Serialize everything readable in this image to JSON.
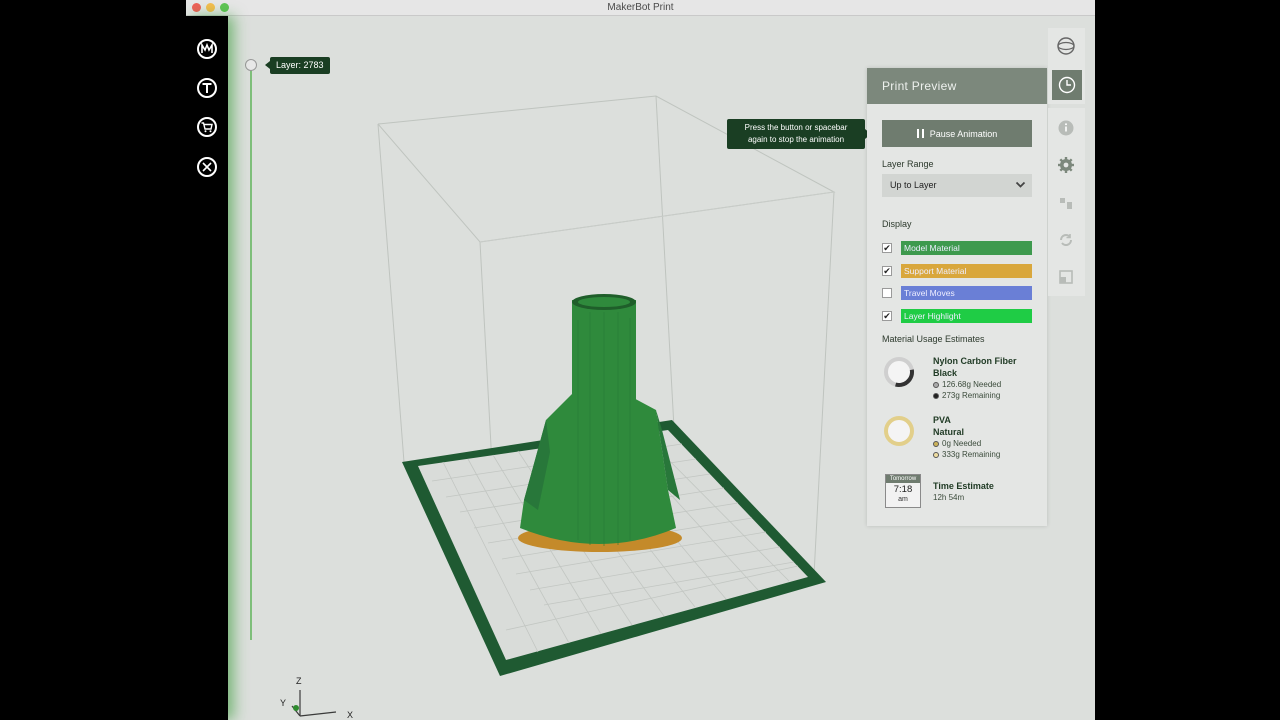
{
  "window": {
    "title": "MakerBot Print"
  },
  "left_nav": {
    "icons": [
      {
        "name": "makerbot-logo-icon",
        "glyph": "M"
      },
      {
        "name": "thingiverse-icon",
        "glyph": "T"
      },
      {
        "name": "store-cart-icon",
        "glyph": "cart"
      },
      {
        "name": "utilities-icon",
        "glyph": "tools"
      }
    ]
  },
  "layer_slider": {
    "label": "Layer: 2783"
  },
  "hint": {
    "line1": "Press the button or spacebar",
    "line2": "again to stop the animation"
  },
  "print_preview": {
    "title": "Print Preview",
    "pause_button": "Pause Animation",
    "layer_range_label": "Layer Range",
    "layer_range_value": "Up to Layer",
    "display_label": "Display",
    "display_items": [
      {
        "label": "Model Material",
        "checked": true,
        "color": "#3e9a4e"
      },
      {
        "label": "Support Material",
        "checked": true,
        "color": "#d9a73c"
      },
      {
        "label": "Travel Moves",
        "checked": false,
        "color": "#6a7fd6"
      },
      {
        "label": "Layer Highlight",
        "checked": true,
        "color": "#1fcc45"
      }
    ],
    "material_usage_label": "Material Usage Estimates",
    "materials": [
      {
        "name_line1": "Nylon Carbon Fiber",
        "name_line2": "Black",
        "needed": "126.68g  Needed",
        "remaining": "273g  Remaining",
        "fill": 0.32,
        "color": "#333333"
      },
      {
        "name_line1": "PVA",
        "name_line2": "Natural",
        "needed": "0g  Needed",
        "remaining": "333g  Remaining",
        "fill": 0.0,
        "color": "#e2cf8a"
      }
    ],
    "time_estimate": {
      "calendar_top": "Tomorrow",
      "calendar_time": "7:18",
      "calendar_ampm": "am",
      "label": "Time Estimate",
      "value": "12h 54m"
    }
  },
  "axes": {
    "z": "Z",
    "y": "Y",
    "x": "X"
  },
  "right_toolbar": {
    "icons": [
      "view-orbit-icon",
      "print-preview-icon",
      "info-icon",
      "settings-gear-icon",
      "arrange-icon",
      "rotate-icon",
      "scale-icon"
    ]
  }
}
